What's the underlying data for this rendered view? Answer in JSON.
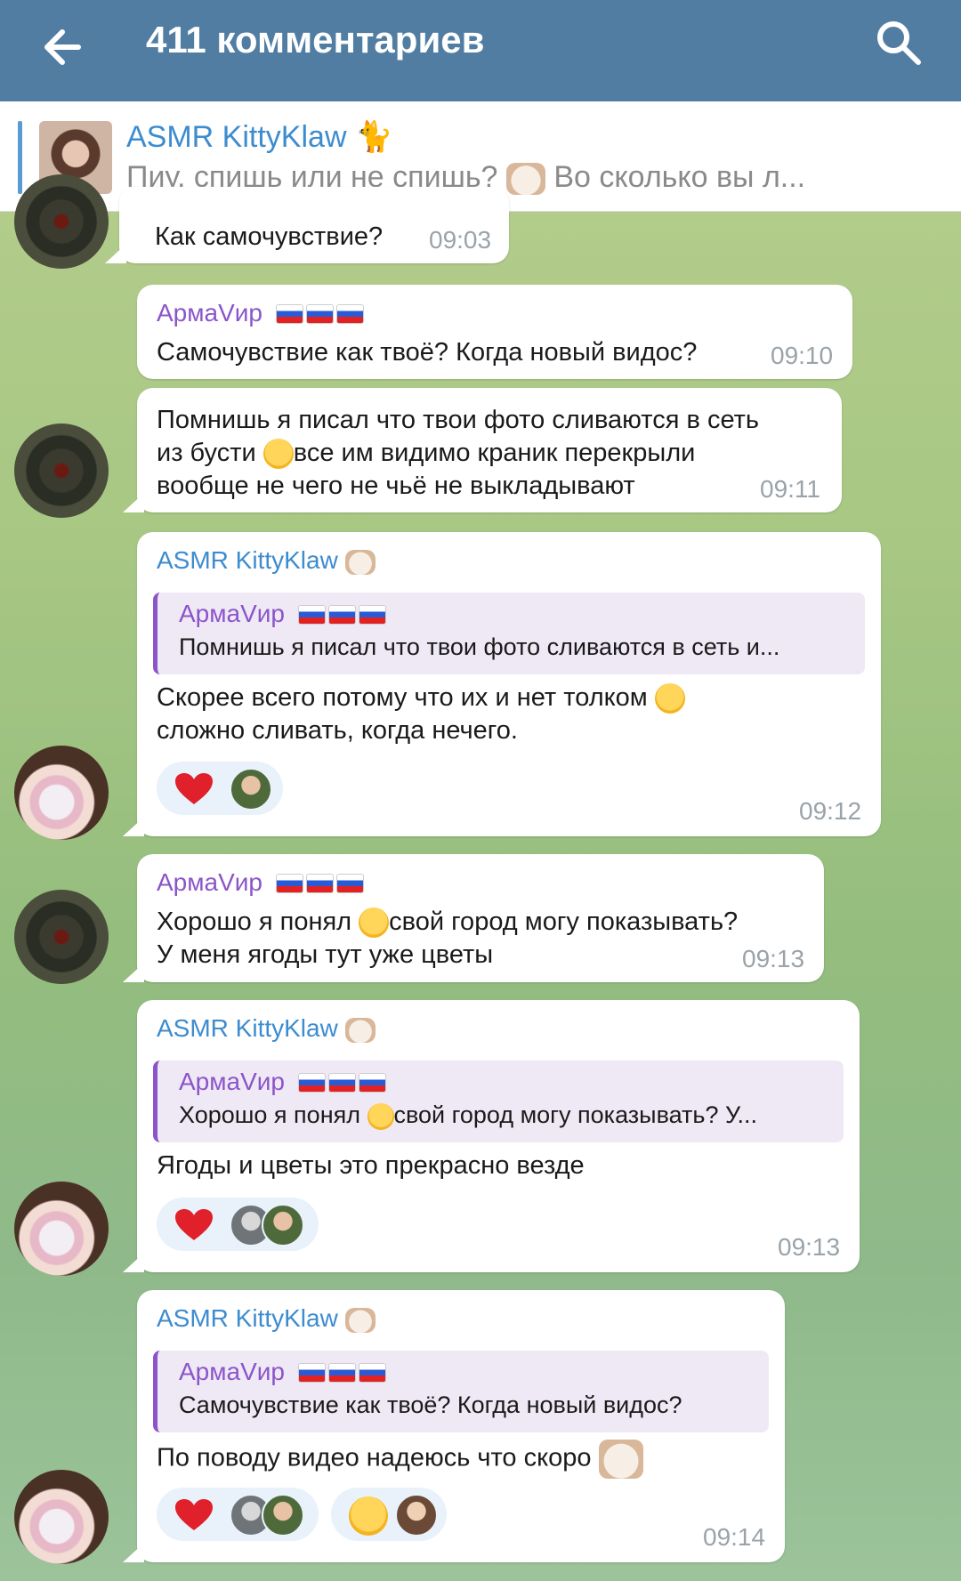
{
  "appbar": {
    "title": "411 комментариев"
  },
  "pinned": {
    "channel": "ASMR KittyKlaw",
    "channel_emoji": "🐈",
    "preview": "Пиу, спишь или не спишь?",
    "preview_tail": "Во сколько вы л..."
  },
  "messages": [
    {
      "text": "Как самочувствие?",
      "time": "09:03"
    },
    {
      "sender": "АрмаVир",
      "text": "Самочувствие как твоё? Когда новый видос?",
      "time": "09:10"
    },
    {
      "lines": [
        "Помнишь я писал что твои фото сливаются в сеть",
        "из бусти",
        "все им видимо краник перекрыли",
        "вообще не чего не чьё не выкладывают"
      ],
      "time": "09:11"
    },
    {
      "sender": "ASMR KittyKlaw",
      "quote_name": "АрмаVир",
      "quote_text": "Помнишь я писал что твои фото сливаются в сеть и...",
      "lines": [
        "Скорее всего потому что их и нет толком",
        "сложно сливать, когда нечего."
      ],
      "time": "09:12"
    },
    {
      "sender": "АрмаVир",
      "lines": [
        "Хорошо я понял",
        "свой город могу показывать?",
        "У меня ягоды тут уже цветы"
      ],
      "time": "09:13"
    },
    {
      "sender": "ASMR KittyKlaw",
      "quote_name": "АрмаVир",
      "quote_text_a": "Хорошо я понял",
      "quote_text_b": "свой город могу показывать? У...",
      "text": "Ягоды и цветы это прекрасно везде",
      "time": "09:13"
    },
    {
      "sender": "ASMR KittyKlaw",
      "quote_name": "АрмаVир",
      "quote_text": "Самочувствие как твоё? Когда новый видос?",
      "text": "По поводу видео надеюсь что скоро",
      "time": "09:14"
    }
  ],
  "colors": {
    "header": "#527da3",
    "accent_blue": "#3d8ccf",
    "accent_purple": "#8b55c9",
    "reaction_bg": "#e9f2fb",
    "heart": "#e0202a"
  },
  "icons": [
    "back-arrow-icon",
    "search-icon",
    "heart-icon",
    "flag-icon",
    "cat-sticker-icon"
  ]
}
